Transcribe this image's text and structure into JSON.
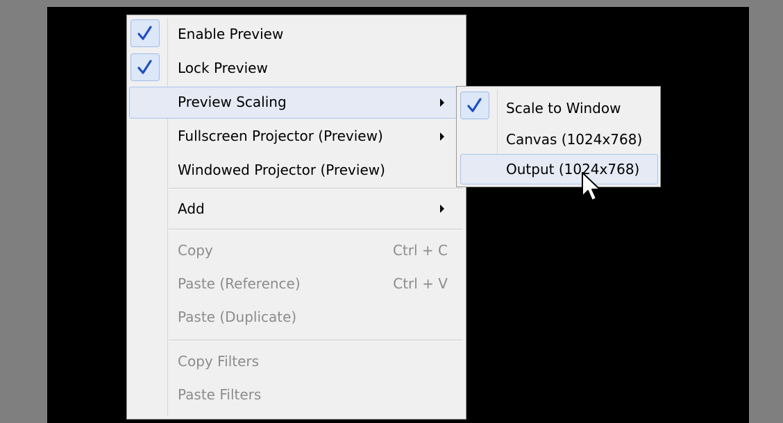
{
  "context_menu": {
    "items": [
      {
        "label": "Enable Preview",
        "checked": true
      },
      {
        "label": "Lock Preview",
        "checked": true
      },
      {
        "label": "Preview Scaling",
        "has_submenu": true,
        "highlighted": true
      },
      {
        "label": "Fullscreen Projector (Preview)",
        "has_submenu": true
      },
      {
        "label": "Windowed Projector (Preview)"
      },
      {
        "label": "Add",
        "has_submenu": true
      },
      {
        "label": "Copy",
        "shortcut": "Ctrl + C",
        "disabled": true
      },
      {
        "label": "Paste (Reference)",
        "shortcut": "Ctrl + V",
        "disabled": true
      },
      {
        "label": "Paste (Duplicate)",
        "disabled": true
      },
      {
        "label": "Copy Filters",
        "disabled": true
      },
      {
        "label": "Paste Filters",
        "disabled": true
      }
    ]
  },
  "scaling_submenu": {
    "items": [
      {
        "label": "Scale to Window",
        "checked": true
      },
      {
        "label": "Canvas (1024x768)"
      },
      {
        "label": "Output (1024x768)",
        "highlighted": true
      }
    ]
  },
  "colors": {
    "outer_background": "#7f7f7f",
    "preview_background": "#000000",
    "menu_background": "#f0f0f0",
    "highlight": "#e5eaf4",
    "checkmark": "#1f4fbf",
    "disabled_text": "#8c8c8c"
  },
  "icons": {
    "check": "checkmark-icon",
    "submenu_arrow": "chevron-right-icon",
    "cursor": "mouse-pointer-icon"
  }
}
